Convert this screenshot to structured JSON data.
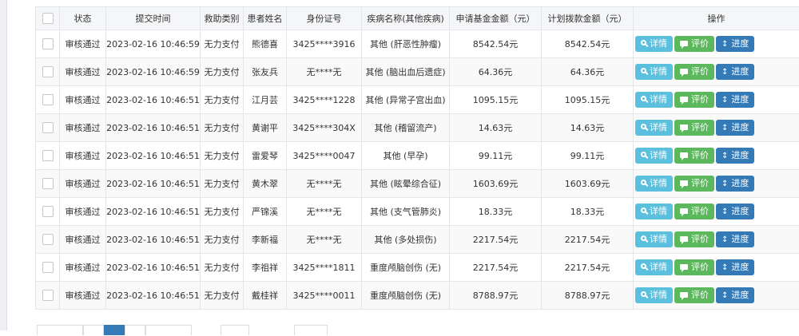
{
  "table": {
    "headers": {
      "status": "状态",
      "submit_time": "提交时间",
      "aid_type": "救助类别",
      "patient_name": "患者姓名",
      "id_number": "身份证号",
      "disease": "疾病名称(其他疾病)",
      "apply_amount": "申请基金金额（元）",
      "plan_amount": "计划拨款金额（元）",
      "actions": "操作"
    },
    "action_labels": {
      "detail": "详情",
      "rate": "评价",
      "progress": "进度"
    },
    "rows": [
      {
        "status": "审核通过",
        "time": "2023-02-16 10:46:59",
        "type": "无力支付",
        "name": "熊德喜",
        "id": "3425****3916",
        "disease": "其他 (肝恶性肿瘤)",
        "apply": "8542.54元",
        "plan": "8542.54元"
      },
      {
        "status": "审核通过",
        "time": "2023-02-16 10:46:59",
        "type": "无力支付",
        "name": "张友兵",
        "id": "无****无",
        "disease": "其他 (脑出血后遗症)",
        "apply": "64.36元",
        "plan": "64.36元"
      },
      {
        "status": "审核通过",
        "time": "2023-02-16 10:46:51",
        "type": "无力支付",
        "name": "江月芸",
        "id": "3425****1228",
        "disease": "其他 (异常子宫出血)",
        "apply": "1095.15元",
        "plan": "1095.15元"
      },
      {
        "status": "审核通过",
        "time": "2023-02-16 10:46:51",
        "type": "无力支付",
        "name": "黄谢平",
        "id": "3425****304X",
        "disease": "其他 (稽留流产)",
        "apply": "14.63元",
        "plan": "14.63元"
      },
      {
        "status": "审核通过",
        "time": "2023-02-16 10:46:51",
        "type": "无力支付",
        "name": "雷爱琴",
        "id": "3425****0047",
        "disease": "其他 (早孕)",
        "apply": "99.11元",
        "plan": "99.11元"
      },
      {
        "status": "审核通过",
        "time": "2023-02-16 10:46:51",
        "type": "无力支付",
        "name": "黄木翠",
        "id": "无****无",
        "disease": "其他 (眩晕综合征)",
        "apply": "1603.69元",
        "plan": "1603.69元"
      },
      {
        "status": "审核通过",
        "time": "2023-02-16 10:46:51",
        "type": "无力支付",
        "name": "严锦溪",
        "id": "无****无",
        "disease": "其他 (支气管肺炎)",
        "apply": "18.33元",
        "plan": "18.33元"
      },
      {
        "status": "审核通过",
        "time": "2023-02-16 10:46:51",
        "type": "无力支付",
        "name": "李新福",
        "id": "无****无",
        "disease": "其他 (多处损伤)",
        "apply": "2217.54元",
        "plan": "2217.54元"
      },
      {
        "status": "审核通过",
        "time": "2023-02-16 10:46:51",
        "type": "无力支付",
        "name": "李祖祥",
        "id": "3425****1811",
        "disease": "重度颅脑创伤 (无)",
        "apply": "2217.54元",
        "plan": "2217.54元"
      },
      {
        "status": "审核通过",
        "time": "2023-02-16 10:46:51",
        "type": "无力支付",
        "name": "戴桂祥",
        "id": "3425****0011",
        "disease": "重度颅脑创伤 (无)",
        "apply": "8788.97元",
        "plan": "8788.97元"
      }
    ]
  },
  "colors": {
    "detail_button": "#5bc0de",
    "rate_button": "#5cb85c",
    "progress_button": "#337ab7"
  },
  "icons": {
    "detail": "search-icon",
    "rate": "comment-icon",
    "progress": "sort-icon"
  }
}
